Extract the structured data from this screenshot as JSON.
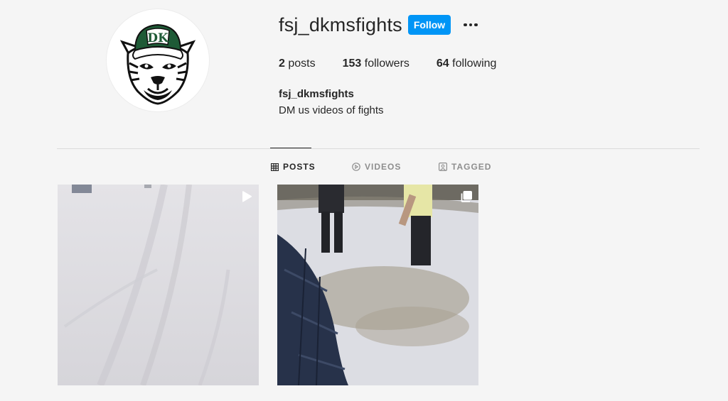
{
  "profile": {
    "username": "fsj_dkmsfights",
    "follow_label": "Follow",
    "full_name": "fsj_dkmsfights",
    "bio": "DM us videos of fights",
    "avatar_cap_text": "DK"
  },
  "stats": {
    "posts_count": "2",
    "posts_label": "posts",
    "followers_count": "153",
    "followers_label": "followers",
    "following_count": "64",
    "following_label": "following"
  },
  "tabs": [
    {
      "label": "POSTS",
      "icon": "grid-icon",
      "active": true
    },
    {
      "label": "VIDEOS",
      "icon": "play-circle-icon",
      "active": false
    },
    {
      "label": "TAGGED",
      "icon": "tagged-person-icon",
      "active": false
    }
  ],
  "posts": [
    {
      "type": "video",
      "badge_icon": "play-icon",
      "description": "snowy road"
    },
    {
      "type": "carousel",
      "badge_icon": "carousel-icon",
      "description": "people in snow"
    }
  ],
  "colors": {
    "accent": "#0095f6",
    "text": "#262626",
    "muted": "#8e8e8e",
    "background": "#f5f5f5",
    "divider": "#dbdbdb",
    "cap_green": "#1e5a36"
  }
}
